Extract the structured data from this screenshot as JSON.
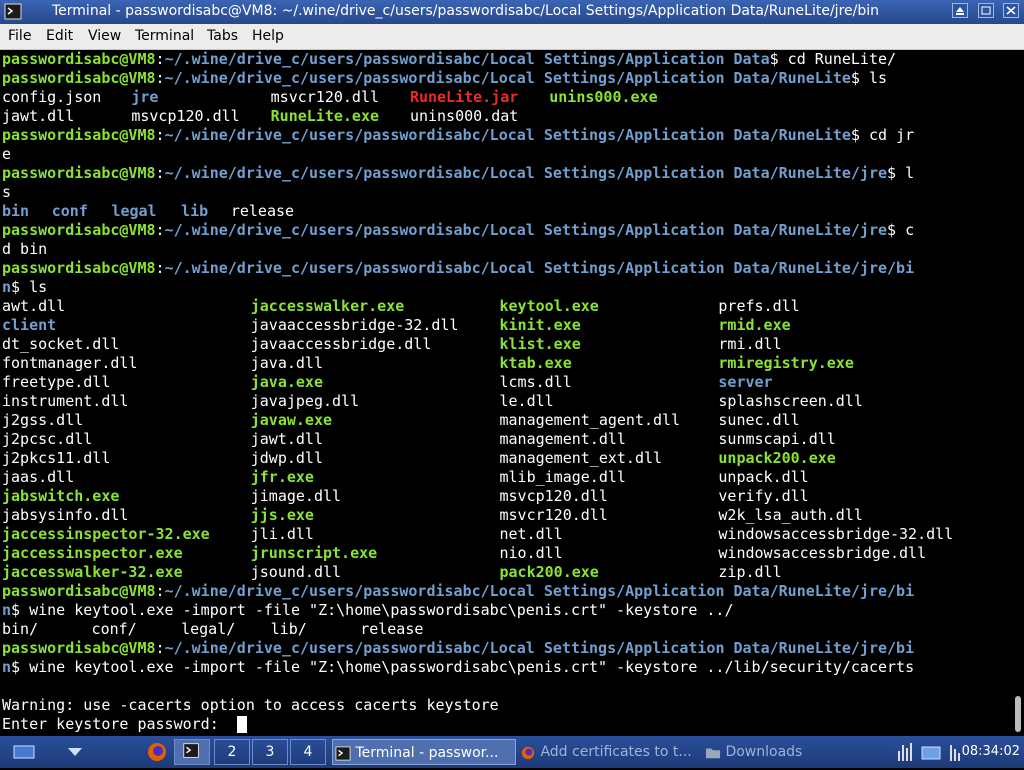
{
  "window": {
    "title": "Terminal - passwordisabc@VM8: ~/.wine/drive_c/users/passwordisabc/Local Settings/Application Data/RuneLite/jre/bin"
  },
  "menu": [
    "File",
    "Edit",
    "View",
    "Terminal",
    "Tabs",
    "Help"
  ],
  "prompt": {
    "user": "passwordisabc@VM8",
    "base": "~/.wine/drive_c/users/passwordisabc/Local Settings/Application Data"
  },
  "lines": [
    {
      "segs": [
        {
          "c": "ug",
          "t": "passwordisabc@VM8"
        },
        {
          "c": "plain",
          "t": ":"
        },
        {
          "c": "pw",
          "t": "~/.wine/drive_c/users/passwordisabc/Local Settings/Application Data"
        },
        {
          "c": "plain",
          "t": "$ cd RuneLite/"
        }
      ]
    },
    {
      "segs": [
        {
          "c": "ug",
          "t": "passwordisabc@VM8"
        },
        {
          "c": "plain",
          "t": ":"
        },
        {
          "c": "pw",
          "t": "~/.wine/drive_c/users/passwordisabc/Local Settings/Application Data/RuneLite"
        },
        {
          "c": "plain",
          "t": "$ ls"
        }
      ]
    },
    {
      "cols": [
        [
          0,
          "plain",
          "config.json"
        ],
        [
          13,
          "dir",
          "jre"
        ],
        [
          27,
          "plain",
          "msvcr120.dll"
        ],
        [
          41,
          "arc",
          "RuneLite.jar"
        ],
        [
          55,
          "exe",
          "unins000.exe"
        ]
      ]
    },
    {
      "cols": [
        [
          0,
          "plain",
          "jawt.dll"
        ],
        [
          13,
          "plain",
          "msvcp120.dll"
        ],
        [
          27,
          "exe",
          "RuneLite.exe"
        ],
        [
          41,
          "plain",
          "unins000.dat"
        ]
      ]
    },
    {
      "segs": [
        {
          "c": "ug",
          "t": "passwordisabc@VM8"
        },
        {
          "c": "plain",
          "t": ":"
        },
        {
          "c": "pw",
          "t": "~/.wine/drive_c/users/passwordisabc/Local Settings/Application Data/RuneLite"
        },
        {
          "c": "plain",
          "t": "$ cd jr"
        }
      ]
    },
    {
      "segs": [
        {
          "c": "plain",
          "t": "e"
        }
      ]
    },
    {
      "segs": [
        {
          "c": "ug",
          "t": "passwordisabc@VM8"
        },
        {
          "c": "plain",
          "t": ":"
        },
        {
          "c": "pw",
          "t": "~/.wine/drive_c/users/passwordisabc/Local Settings/Application Data/RuneLite/jre"
        },
        {
          "c": "plain",
          "t": "$ l"
        }
      ]
    },
    {
      "segs": [
        {
          "c": "plain",
          "t": "s"
        }
      ]
    },
    {
      "cols": [
        [
          0,
          "dir",
          "bin"
        ],
        [
          5,
          "dir",
          "conf"
        ],
        [
          11,
          "dir",
          "legal"
        ],
        [
          18,
          "dir",
          "lib"
        ],
        [
          23,
          "plain",
          "release"
        ]
      ]
    },
    {
      "segs": [
        {
          "c": "ug",
          "t": "passwordisabc@VM8"
        },
        {
          "c": "plain",
          "t": ":"
        },
        {
          "c": "pw",
          "t": "~/.wine/drive_c/users/passwordisabc/Local Settings/Application Data/RuneLite/jre"
        },
        {
          "c": "plain",
          "t": "$ c"
        }
      ]
    },
    {
      "segs": [
        {
          "c": "plain",
          "t": "d bin"
        }
      ]
    },
    {
      "segs": [
        {
          "c": "ug",
          "t": "passwordisabc@VM8"
        },
        {
          "c": "plain",
          "t": ":"
        },
        {
          "c": "pw",
          "t": "~/.wine/drive_c/users/passwordisabc/Local Settings/Application Data/RuneLite/jre/bi"
        }
      ]
    },
    {
      "segs": [
        {
          "c": "pw",
          "t": "n"
        },
        {
          "c": "plain",
          "t": "$ ls"
        }
      ]
    },
    {
      "cols": [
        [
          0,
          "plain",
          "awt.dll"
        ],
        [
          25,
          "exe",
          "jaccesswalker.exe"
        ],
        [
          50,
          "exe",
          "keytool.exe"
        ],
        [
          72,
          "plain",
          "prefs.dll"
        ]
      ]
    },
    {
      "cols": [
        [
          0,
          "dir",
          "client"
        ],
        [
          25,
          "plain",
          "javaaccessbridge-32.dll"
        ],
        [
          50,
          "exe",
          "kinit.exe"
        ],
        [
          72,
          "exe",
          "rmid.exe"
        ]
      ]
    },
    {
      "cols": [
        [
          0,
          "plain",
          "dt_socket.dll"
        ],
        [
          25,
          "plain",
          "javaaccessbridge.dll"
        ],
        [
          50,
          "exe",
          "klist.exe"
        ],
        [
          72,
          "plain",
          "rmi.dll"
        ]
      ]
    },
    {
      "cols": [
        [
          0,
          "plain",
          "fontmanager.dll"
        ],
        [
          25,
          "plain",
          "java.dll"
        ],
        [
          50,
          "exe",
          "ktab.exe"
        ],
        [
          72,
          "exe",
          "rmiregistry.exe"
        ]
      ]
    },
    {
      "cols": [
        [
          0,
          "plain",
          "freetype.dll"
        ],
        [
          25,
          "exe",
          "java.exe"
        ],
        [
          50,
          "plain",
          "lcms.dll"
        ],
        [
          72,
          "dir",
          "server"
        ]
      ]
    },
    {
      "cols": [
        [
          0,
          "plain",
          "instrument.dll"
        ],
        [
          25,
          "plain",
          "javajpeg.dll"
        ],
        [
          50,
          "plain",
          "le.dll"
        ],
        [
          72,
          "plain",
          "splashscreen.dll"
        ]
      ]
    },
    {
      "cols": [
        [
          0,
          "plain",
          "j2gss.dll"
        ],
        [
          25,
          "exe",
          "javaw.exe"
        ],
        [
          50,
          "plain",
          "management_agent.dll"
        ],
        [
          72,
          "plain",
          "sunec.dll"
        ]
      ]
    },
    {
      "cols": [
        [
          0,
          "plain",
          "j2pcsc.dll"
        ],
        [
          25,
          "plain",
          "jawt.dll"
        ],
        [
          50,
          "plain",
          "management.dll"
        ],
        [
          72,
          "plain",
          "sunmscapi.dll"
        ]
      ]
    },
    {
      "cols": [
        [
          0,
          "plain",
          "j2pkcs11.dll"
        ],
        [
          25,
          "plain",
          "jdwp.dll"
        ],
        [
          50,
          "plain",
          "management_ext.dll"
        ],
        [
          72,
          "exe",
          "unpack200.exe"
        ]
      ]
    },
    {
      "cols": [
        [
          0,
          "plain",
          "jaas.dll"
        ],
        [
          25,
          "exe",
          "jfr.exe"
        ],
        [
          50,
          "plain",
          "mlib_image.dll"
        ],
        [
          72,
          "plain",
          "unpack.dll"
        ]
      ]
    },
    {
      "cols": [
        [
          0,
          "exe",
          "jabswitch.exe"
        ],
        [
          25,
          "plain",
          "jimage.dll"
        ],
        [
          50,
          "plain",
          "msvcp120.dll"
        ],
        [
          72,
          "plain",
          "verify.dll"
        ]
      ]
    },
    {
      "cols": [
        [
          0,
          "plain",
          "jabsysinfo.dll"
        ],
        [
          25,
          "exe",
          "jjs.exe"
        ],
        [
          50,
          "plain",
          "msvcr120.dll"
        ],
        [
          72,
          "plain",
          "w2k_lsa_auth.dll"
        ]
      ]
    },
    {
      "cols": [
        [
          0,
          "exe",
          "jaccessinspector-32.exe"
        ],
        [
          25,
          "plain",
          "jli.dll"
        ],
        [
          50,
          "plain",
          "net.dll"
        ],
        [
          72,
          "plain",
          "windowsaccessbridge-32.dll"
        ]
      ]
    },
    {
      "cols": [
        [
          0,
          "exe",
          "jaccessinspector.exe"
        ],
        [
          25,
          "exe",
          "jrunscript.exe"
        ],
        [
          50,
          "plain",
          "nio.dll"
        ],
        [
          72,
          "plain",
          "windowsaccessbridge.dll"
        ]
      ]
    },
    {
      "cols": [
        [
          0,
          "exe",
          "jaccesswalker-32.exe"
        ],
        [
          25,
          "plain",
          "jsound.dll"
        ],
        [
          50,
          "exe",
          "pack200.exe"
        ],
        [
          72,
          "plain",
          "zip.dll"
        ]
      ]
    },
    {
      "segs": [
        {
          "c": "ug",
          "t": "passwordisabc@VM8"
        },
        {
          "c": "plain",
          "t": ":"
        },
        {
          "c": "pw",
          "t": "~/.wine/drive_c/users/passwordisabc/Local Settings/Application Data/RuneLite/jre/bi"
        }
      ]
    },
    {
      "segs": [
        {
          "c": "pw",
          "t": "n"
        },
        {
          "c": "plain",
          "t": "$ wine keytool.exe -import -file \"Z:\\home\\passwordisabc\\penis.crt\" -keystore ../"
        }
      ]
    },
    {
      "cols": [
        [
          0,
          "plain",
          "bin/"
        ],
        [
          9,
          "plain",
          "conf/"
        ],
        [
          18,
          "plain",
          "legal/"
        ],
        [
          27,
          "plain",
          "lib/"
        ],
        [
          36,
          "plain",
          "release"
        ]
      ]
    },
    {
      "segs": [
        {
          "c": "ug",
          "t": "passwordisabc@VM8"
        },
        {
          "c": "plain",
          "t": ":"
        },
        {
          "c": "pw",
          "t": "~/.wine/drive_c/users/passwordisabc/Local Settings/Application Data/RuneLite/jre/bi"
        }
      ]
    },
    {
      "segs": [
        {
          "c": "pw",
          "t": "n"
        },
        {
          "c": "plain",
          "t": "$ wine keytool.exe -import -file \"Z:\\home\\passwordisabc\\penis.crt\" -keystore ../lib/security/cacerts"
        }
      ]
    },
    {
      "segs": [
        {
          "c": "plain",
          "t": ""
        }
      ]
    },
    {
      "segs": [
        {
          "c": "plain",
          "t": "Warning: use -cacerts option to access cacerts keystore"
        }
      ]
    },
    {
      "segs": [
        {
          "c": "plain",
          "t": "Enter keystore password:  "
        }
      ],
      "cursor": true
    }
  ],
  "taskbar": {
    "workspaces": [
      "2",
      "3",
      "4"
    ],
    "tasks": [
      {
        "label": "Terminal - passwor...",
        "active": true
      },
      {
        "label": "Add certificates to t...",
        "active": false
      },
      {
        "label": "Downloads",
        "active": false
      }
    ],
    "clock": "08:34:02"
  }
}
